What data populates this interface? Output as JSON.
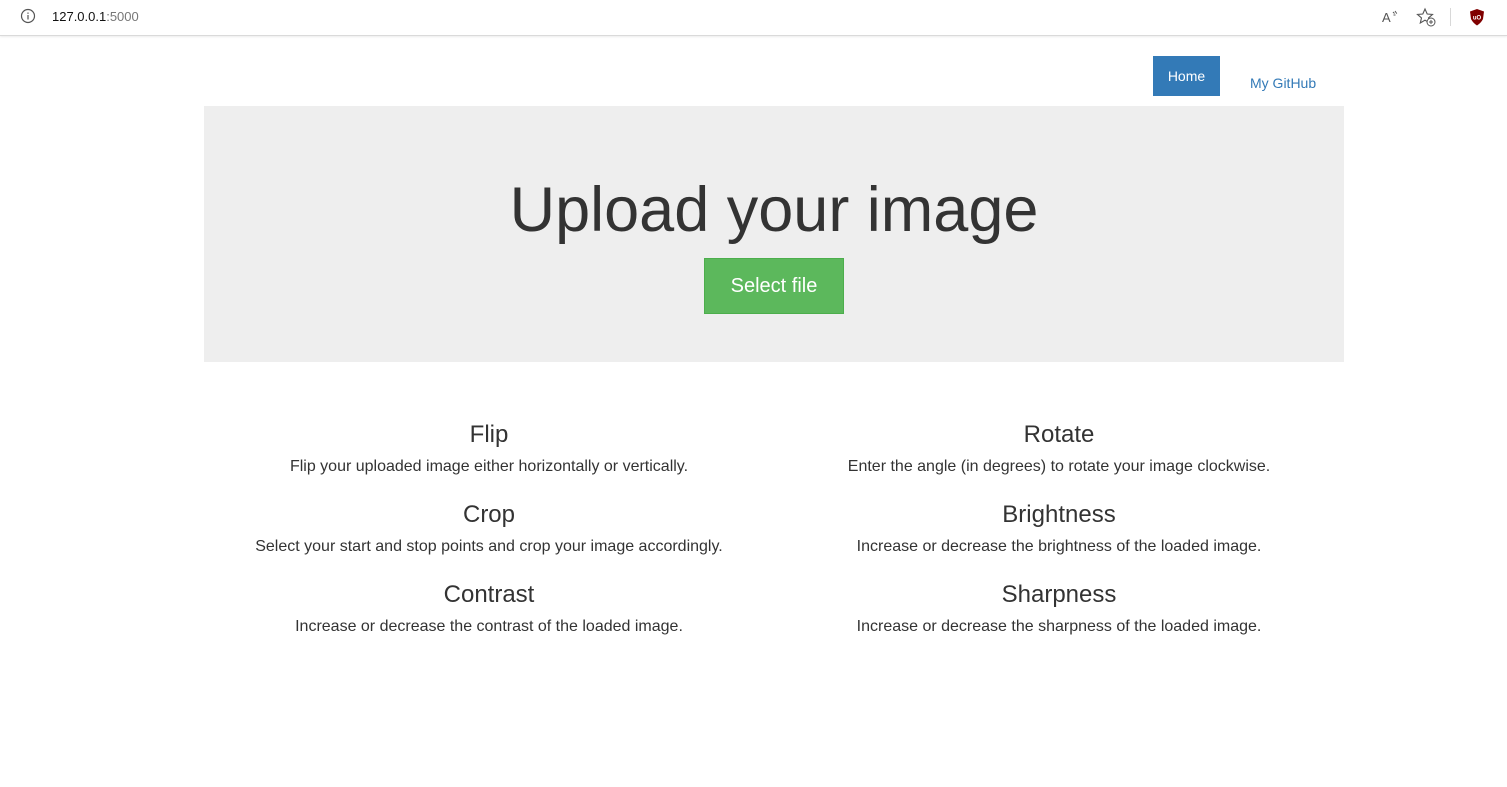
{
  "browser": {
    "url_host": "127.0.0.1",
    "url_port": ":5000",
    "icons": [
      "info-icon",
      "read-aloud-icon",
      "favorite-add-icon",
      "ublock-icon"
    ]
  },
  "nav": {
    "home_label": "Home",
    "github_label": "My GitHub"
  },
  "hero": {
    "title": "Upload your image",
    "button_label": "Select file"
  },
  "features": [
    {
      "title": "Flip",
      "description": "Flip your uploaded image either horizontally or vertically."
    },
    {
      "title": "Rotate",
      "description": "Enter the angle (in degrees) to rotate your image clockwise."
    },
    {
      "title": "Crop",
      "description": "Select your start and stop points and crop your image accordingly."
    },
    {
      "title": "Brightness",
      "description": "Increase or decrease the brightness of the loaded image."
    },
    {
      "title": "Contrast",
      "description": "Increase or decrease the contrast of the loaded image."
    },
    {
      "title": "Sharpness",
      "description": "Increase or decrease the sharpness of the loaded image."
    }
  ],
  "colors": {
    "primary": "#337ab7",
    "success": "#5cb85c",
    "jumbotron_bg": "#eeeeee",
    "text": "#333333"
  }
}
